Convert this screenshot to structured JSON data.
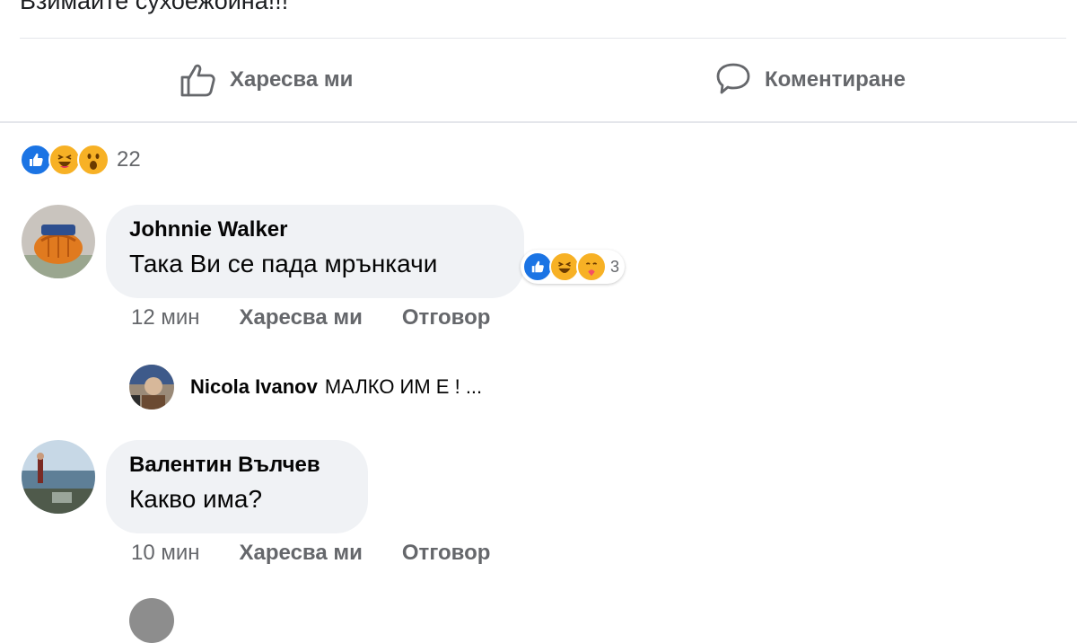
{
  "post": {
    "text_partial": "Взимайте сухоежойна!!!"
  },
  "actions": {
    "like_label": "Харесва ми",
    "comment_label": "Коментиране"
  },
  "reactions": {
    "types": [
      "like",
      "haha",
      "wow"
    ],
    "count": "22"
  },
  "comments": [
    {
      "author": "Johnnie Walker",
      "text": "Така Ви се пада мрънкачи",
      "time": "12 мин",
      "like_label": "Харесва ми",
      "reply_label": "Отговор",
      "reactions": {
        "types": [
          "like",
          "haha",
          "care"
        ],
        "count": "3"
      },
      "reply_preview": {
        "author": "Nicola Ivanov",
        "text": "МАЛКО ИМ Е ! ..."
      }
    },
    {
      "author": "Валентин Вълчев",
      "text": "Какво има?",
      "time": "10 мин",
      "like_label": "Харесва ми",
      "reply_label": "Отговор"
    }
  ],
  "colors": {
    "like_blue": "#1b74e4",
    "emoji_yellow": "#f7b125",
    "bubble_bg": "#f0f2f5",
    "secondary_text": "#65676b"
  }
}
